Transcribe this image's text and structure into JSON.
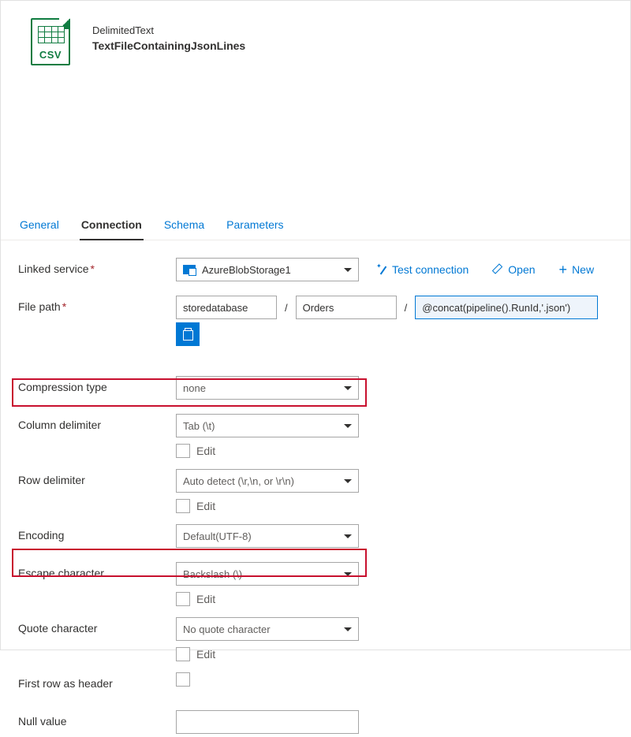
{
  "header": {
    "type_label": "DelimitedText",
    "title": "TextFileContainingJsonLines",
    "icon_badge": "CSV"
  },
  "tabs": [
    {
      "id": "general",
      "label": "General"
    },
    {
      "id": "connection",
      "label": "Connection",
      "active": true
    },
    {
      "id": "schema",
      "label": "Schema"
    },
    {
      "id": "parameters",
      "label": "Parameters"
    }
  ],
  "actions": {
    "test": "Test connection",
    "open": "Open",
    "new": "New"
  },
  "fields": {
    "linked_service": {
      "label": "Linked service",
      "required": true,
      "value": "AzureBlobStorage1"
    },
    "file_path": {
      "label": "File path",
      "required": true,
      "container": "storedatabase",
      "directory": "Orders",
      "filename": "@concat(pipeline().RunId,'.json')"
    },
    "compression": {
      "label": "Compression type",
      "value": "none"
    },
    "col_delim": {
      "label": "Column delimiter",
      "value": "Tab (\\t)",
      "edit": "Edit"
    },
    "row_delim": {
      "label": "Row delimiter",
      "value": "Auto detect (\\r,\\n, or \\r\\n)",
      "edit": "Edit"
    },
    "encoding": {
      "label": "Encoding",
      "value": "Default(UTF-8)"
    },
    "escape": {
      "label": "Escape character",
      "value": "Backslash (\\)",
      "edit": "Edit"
    },
    "quote": {
      "label": "Quote character",
      "value": "No quote character",
      "edit": "Edit"
    },
    "first_row": {
      "label": "First row as header"
    },
    "null_value": {
      "label": "Null value",
      "value": ""
    }
  }
}
